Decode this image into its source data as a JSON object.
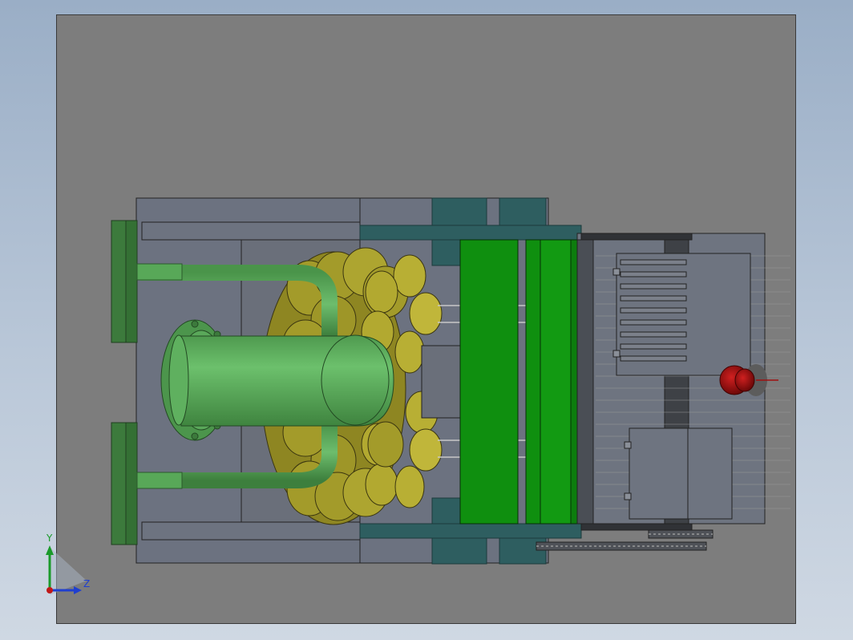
{
  "triad": {
    "y_label": "Y",
    "z_label": "Z",
    "colors": {
      "y": "#1a9a2a",
      "z": "#1f3fd0",
      "x": "#c01818"
    }
  },
  "colors": {
    "background_top": "#9aaec6",
    "viewport": "#7d7d7d",
    "frame": "#6c7280",
    "pipe_green": "#58a858",
    "tank_green": "#5bb05b",
    "cylinder_olive": "#a39b2a",
    "bright_green": "#0f8f0f",
    "teal": "#2e5e60",
    "dark_green_flange": "#3c7a3c",
    "red_knob": "#b00e0e"
  }
}
